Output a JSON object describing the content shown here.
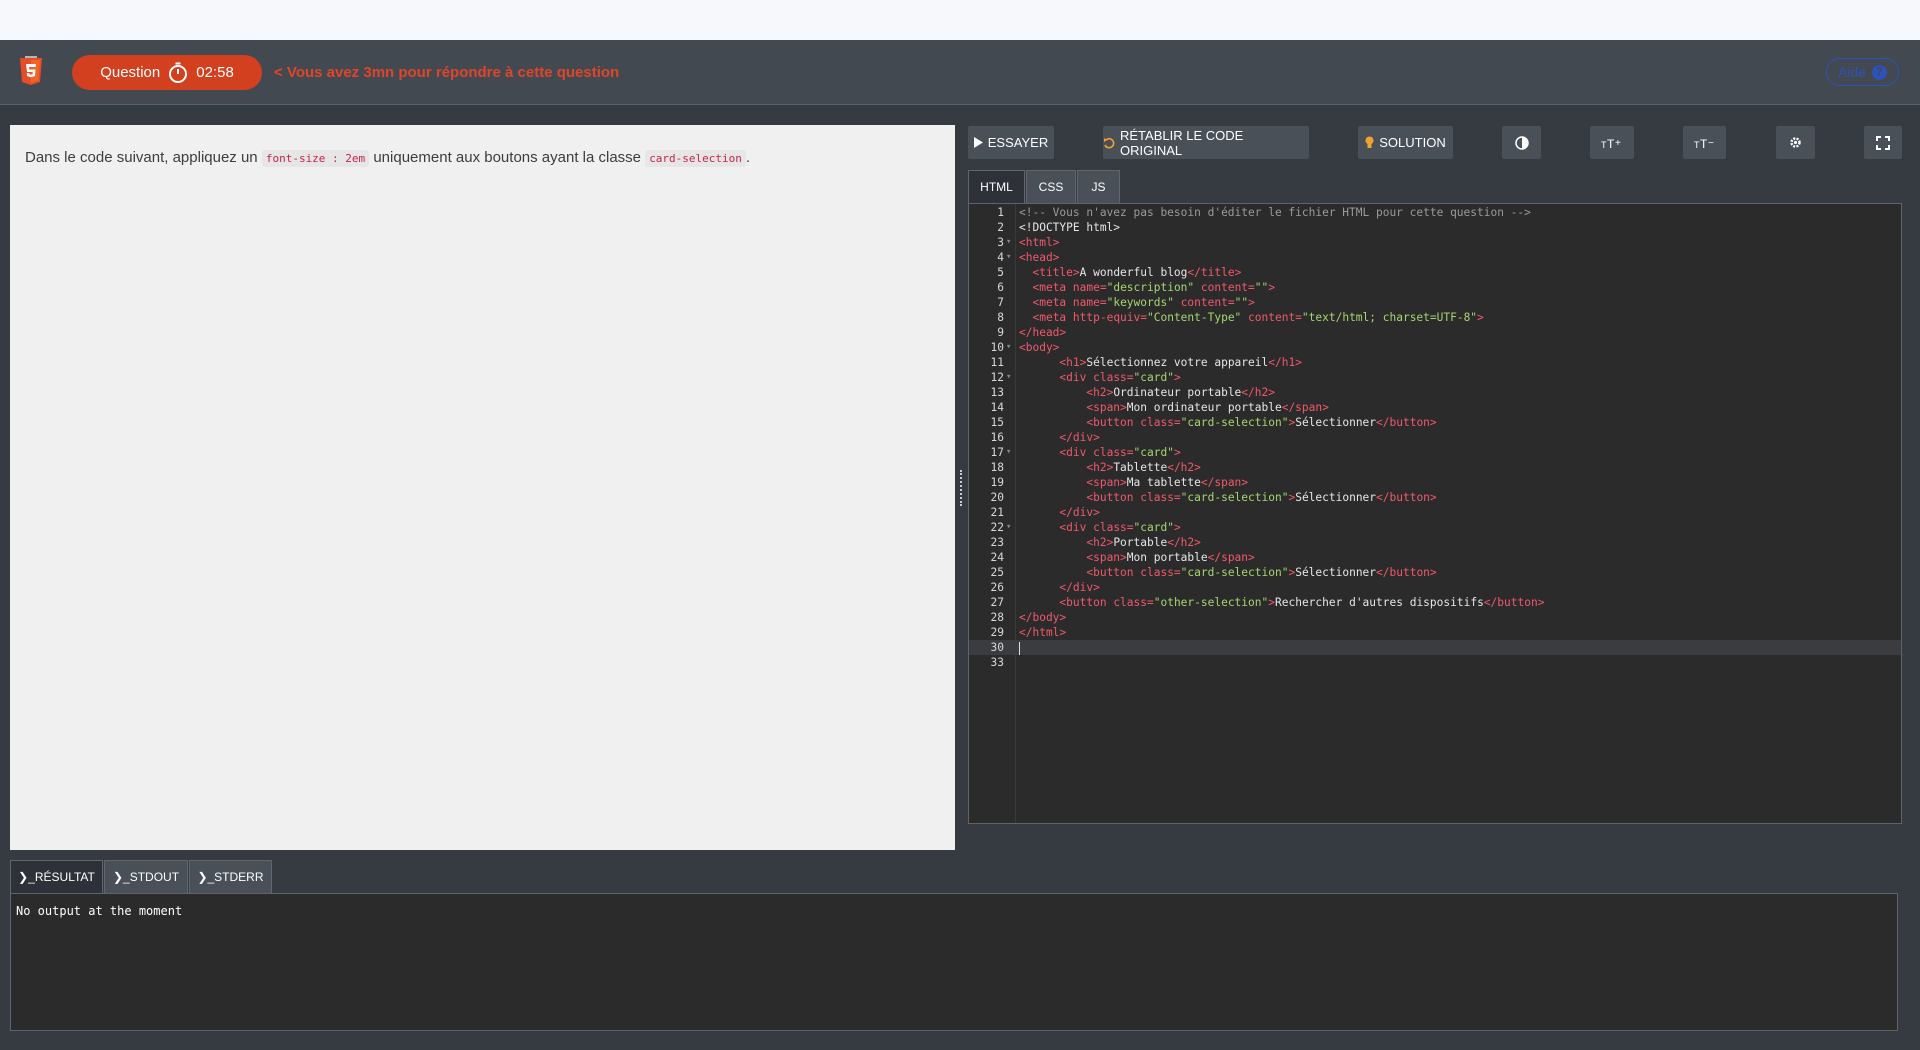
{
  "header": {
    "logo_icon": "html5-logo-icon",
    "question_label": "Question",
    "timer_icon": "stopwatch-icon",
    "timer": "02:58",
    "warning": "< Vous avez 3mn pour répondre à cette question",
    "help_label": "Aide",
    "help_icon": "question-circle-icon",
    "accent_color": "#d2401f"
  },
  "instruction": {
    "before": "Dans le code suivant, appliquez un ",
    "code1": "font-size : 2em",
    "middle": " uniquement aux boutons ayant la classe ",
    "code2": "card-selection",
    "after": "."
  },
  "toolbar": {
    "run_label": "ESSAYER",
    "reset_label": "RÉTABLIR LE CODE ORIGINAL",
    "solution_label": "SOLUTION",
    "theme_icon": "contrast-icon",
    "font_increase_icon": "font-size-increase-icon",
    "font_decrease_icon": "font-size-decrease-icon",
    "settings_icon": "gear-icon",
    "fullscreen_icon": "fullscreen-icon"
  },
  "editor_tabs": [
    "HTML",
    "CSS",
    "JS"
  ],
  "active_editor_tab": "HTML",
  "code_lines": [
    {
      "n": "1",
      "fold": false,
      "segs": [
        [
          "cm",
          "<!-- Vous n'avez pas besoin d'éditer le fichier HTML pour cette question -->"
        ]
      ]
    },
    {
      "n": "2",
      "fold": false,
      "segs": [
        [
          "pl",
          "<!DOCTYPE html>"
        ]
      ]
    },
    {
      "n": "3",
      "fold": true,
      "segs": [
        [
          "tg",
          "<html>"
        ]
      ]
    },
    {
      "n": "4",
      "fold": true,
      "segs": [
        [
          "tg",
          "<head>"
        ]
      ]
    },
    {
      "n": "5",
      "fold": false,
      "segs": [
        [
          "pl",
          "  "
        ],
        [
          "tg",
          "<title>"
        ],
        [
          "pl",
          "A wonderful blog"
        ],
        [
          "tg",
          "</title>"
        ]
      ]
    },
    {
      "n": "6",
      "fold": false,
      "segs": [
        [
          "pl",
          "  "
        ],
        [
          "tg",
          "<meta "
        ],
        [
          "at",
          "name="
        ],
        [
          "st",
          "\"description\""
        ],
        [
          "at",
          " content="
        ],
        [
          "st",
          "\"\""
        ],
        [
          "tg",
          ">"
        ]
      ]
    },
    {
      "n": "7",
      "fold": false,
      "segs": [
        [
          "pl",
          "  "
        ],
        [
          "tg",
          "<meta "
        ],
        [
          "at",
          "name="
        ],
        [
          "st",
          "\"keywords\""
        ],
        [
          "at",
          " content="
        ],
        [
          "st",
          "\"\""
        ],
        [
          "tg",
          ">"
        ]
      ]
    },
    {
      "n": "8",
      "fold": false,
      "segs": [
        [
          "pl",
          "  "
        ],
        [
          "tg",
          "<meta "
        ],
        [
          "at",
          "http-equiv="
        ],
        [
          "st",
          "\"Content-Type\""
        ],
        [
          "at",
          " content="
        ],
        [
          "st",
          "\"text/html; charset=UTF-8\""
        ],
        [
          "tg",
          ">"
        ]
      ]
    },
    {
      "n": "9",
      "fold": false,
      "segs": [
        [
          "tg",
          "</head>"
        ]
      ]
    },
    {
      "n": "10",
      "fold": true,
      "segs": [
        [
          "tg",
          "<body>"
        ]
      ]
    },
    {
      "n": "11",
      "fold": false,
      "segs": [
        [
          "pl",
          "      "
        ],
        [
          "tg",
          "<h1>"
        ],
        [
          "pl",
          "Sélectionnez votre appareil"
        ],
        [
          "tg",
          "</h1>"
        ]
      ]
    },
    {
      "n": "12",
      "fold": true,
      "segs": [
        [
          "pl",
          "      "
        ],
        [
          "tg",
          "<div "
        ],
        [
          "at",
          "class="
        ],
        [
          "st",
          "\"card\""
        ],
        [
          "tg",
          ">"
        ]
      ]
    },
    {
      "n": "13",
      "fold": false,
      "segs": [
        [
          "pl",
          "          "
        ],
        [
          "tg",
          "<h2>"
        ],
        [
          "pl",
          "Ordinateur portable"
        ],
        [
          "tg",
          "</h2>"
        ]
      ]
    },
    {
      "n": "14",
      "fold": false,
      "segs": [
        [
          "pl",
          "          "
        ],
        [
          "tg",
          "<span>"
        ],
        [
          "pl",
          "Mon ordinateur portable"
        ],
        [
          "tg",
          "</span>"
        ]
      ]
    },
    {
      "n": "15",
      "fold": false,
      "segs": [
        [
          "pl",
          "          "
        ],
        [
          "tg",
          "<button "
        ],
        [
          "at",
          "class="
        ],
        [
          "st",
          "\"card-selection\""
        ],
        [
          "tg",
          ">"
        ],
        [
          "pl",
          "Sélectionner"
        ],
        [
          "tg",
          "</button>"
        ]
      ]
    },
    {
      "n": "16",
      "fold": false,
      "segs": [
        [
          "pl",
          "      "
        ],
        [
          "tg",
          "</div>"
        ]
      ]
    },
    {
      "n": "17",
      "fold": true,
      "segs": [
        [
          "pl",
          "      "
        ],
        [
          "tg",
          "<div "
        ],
        [
          "at",
          "class="
        ],
        [
          "st",
          "\"card\""
        ],
        [
          "tg",
          ">"
        ]
      ]
    },
    {
      "n": "18",
      "fold": false,
      "segs": [
        [
          "pl",
          "          "
        ],
        [
          "tg",
          "<h2>"
        ],
        [
          "pl",
          "Tablette"
        ],
        [
          "tg",
          "</h2>"
        ]
      ]
    },
    {
      "n": "19",
      "fold": false,
      "segs": [
        [
          "pl",
          "          "
        ],
        [
          "tg",
          "<span>"
        ],
        [
          "pl",
          "Ma tablette"
        ],
        [
          "tg",
          "</span>"
        ]
      ]
    },
    {
      "n": "20",
      "fold": false,
      "segs": [
        [
          "pl",
          "          "
        ],
        [
          "tg",
          "<button "
        ],
        [
          "at",
          "class="
        ],
        [
          "st",
          "\"card-selection\""
        ],
        [
          "tg",
          ">"
        ],
        [
          "pl",
          "Sélectionner"
        ],
        [
          "tg",
          "</button>"
        ]
      ]
    },
    {
      "n": "21",
      "fold": false,
      "segs": [
        [
          "pl",
          "      "
        ],
        [
          "tg",
          "</div>"
        ]
      ]
    },
    {
      "n": "22",
      "fold": true,
      "segs": [
        [
          "pl",
          "      "
        ],
        [
          "tg",
          "<div "
        ],
        [
          "at",
          "class="
        ],
        [
          "st",
          "\"card\""
        ],
        [
          "tg",
          ">"
        ]
      ]
    },
    {
      "n": "23",
      "fold": false,
      "segs": [
        [
          "pl",
          "          "
        ],
        [
          "tg",
          "<h2>"
        ],
        [
          "pl",
          "Portable"
        ],
        [
          "tg",
          "</h2>"
        ]
      ]
    },
    {
      "n": "24",
      "fold": false,
      "segs": [
        [
          "pl",
          "          "
        ],
        [
          "tg",
          "<span>"
        ],
        [
          "pl",
          "Mon portable"
        ],
        [
          "tg",
          "</span>"
        ]
      ]
    },
    {
      "n": "25",
      "fold": false,
      "segs": [
        [
          "pl",
          "          "
        ],
        [
          "tg",
          "<button "
        ],
        [
          "at",
          "class="
        ],
        [
          "st",
          "\"card-selection\""
        ],
        [
          "tg",
          ">"
        ],
        [
          "pl",
          "Sélectionner"
        ],
        [
          "tg",
          "</button>"
        ]
      ]
    },
    {
      "n": "26",
      "fold": false,
      "segs": [
        [
          "pl",
          "      "
        ],
        [
          "tg",
          "</div>"
        ]
      ]
    },
    {
      "n": "27",
      "fold": false,
      "segs": [
        [
          "pl",
          "      "
        ],
        [
          "tg",
          "<button "
        ],
        [
          "at",
          "class="
        ],
        [
          "st",
          "\"other-selection\""
        ],
        [
          "tg",
          ">"
        ],
        [
          "pl",
          "Rechercher d'autres dispositifs"
        ],
        [
          "tg",
          "</button>"
        ]
      ]
    },
    {
      "n": "28",
      "fold": false,
      "segs": [
        [
          "tg",
          "</body>"
        ]
      ]
    },
    {
      "n": "29",
      "fold": false,
      "segs": [
        [
          "tg",
          "</html>"
        ]
      ]
    },
    {
      "n": "30",
      "fold": false,
      "current": true,
      "segs": []
    },
    {
      "n": "33",
      "fold": false,
      "segs": []
    }
  ],
  "output_tabs": [
    "❯_RÉSULTAT",
    "❯_STDOUT",
    "❯_STDERR"
  ],
  "active_output_tab": "❯_RÉSULTAT",
  "output_text": "No output at the moment"
}
